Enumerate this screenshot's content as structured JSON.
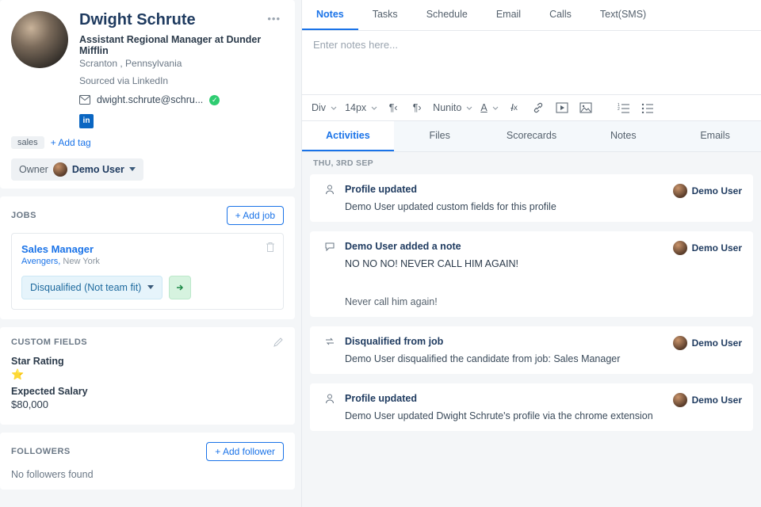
{
  "profile": {
    "name": "Dwight Schrute",
    "title_line": "Assistant Regional Manager at Dunder Mifflin",
    "location": "Scranton , Pennsylvania",
    "sourced": "Sourced via LinkedIn",
    "email": "dwight.schrute@schru...",
    "more_icon": "more-horizontal-icon"
  },
  "tags": {
    "items": [
      "sales"
    ],
    "add_label": "+ Add tag"
  },
  "owner": {
    "label": "Owner",
    "name": "Demo User"
  },
  "jobs": {
    "section_label": "JOBS",
    "add_label": "+ Add job",
    "item": {
      "title": "Sales Manager",
      "company": "Avengers,",
      "location": "New York",
      "status": "Disqualified (Not team fit)"
    }
  },
  "custom_fields": {
    "section_label": "CUSTOM FIELDS",
    "star_label": "Star Rating",
    "star_value": "⭐",
    "salary_label": "Expected Salary",
    "salary_value": "$80,000"
  },
  "followers": {
    "section_label": "FOLLOWERS",
    "add_label": "+ Add follower",
    "empty": "No followers found"
  },
  "comm_tabs": [
    "Notes",
    "Tasks",
    "Schedule",
    "Email",
    "Calls",
    "Text(SMS)"
  ],
  "editor": {
    "placeholder": "Enter notes here..."
  },
  "toolbar": {
    "block": "Div",
    "size": "14px",
    "font": "Nunito"
  },
  "sec_tabs": [
    "Activities",
    "Files",
    "Scorecards",
    "Notes",
    "Emails"
  ],
  "feed": {
    "date": "THU, 3RD SEP",
    "user": "Demo User",
    "items": [
      {
        "icon": "profile",
        "title": "Profile updated",
        "body": "Demo User updated custom fields for this profile"
      },
      {
        "icon": "note",
        "title": "Demo User added a note",
        "body": "NO NO NO! NEVER CALL HIM AGAIN!",
        "body2": "Never call him again!"
      },
      {
        "icon": "transfer",
        "title": "Disqualified from job",
        "body": "Demo User disqualified the candidate from job: Sales Manager"
      },
      {
        "icon": "profile",
        "title": "Profile updated",
        "body": "Demo User updated Dwight Schrute's profile via the chrome extension"
      }
    ]
  }
}
